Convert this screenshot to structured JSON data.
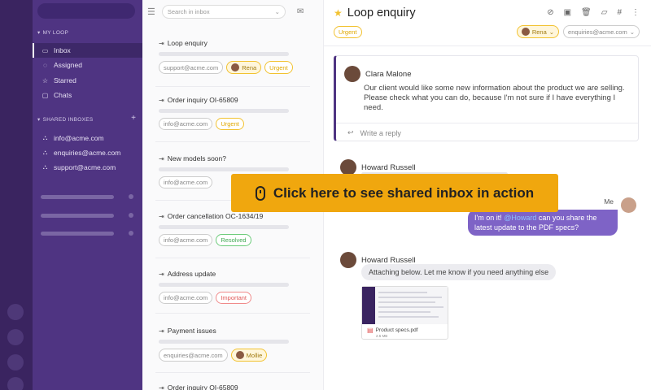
{
  "sidebar": {
    "my_loop_label": "MY LOOP",
    "items": [
      {
        "label": "Inbox",
        "icon": "inbox-icon"
      },
      {
        "label": "Assigned",
        "icon": "user-icon"
      },
      {
        "label": "Starred",
        "icon": "star-icon"
      },
      {
        "label": "Chats",
        "icon": "chat-icon"
      }
    ],
    "shared_label": "SHARED INBOXES",
    "shared_items": [
      {
        "label": "info@acme.com"
      },
      {
        "label": "enquiries@acme.com"
      },
      {
        "label": "support@acme.com"
      }
    ],
    "plus": "+"
  },
  "list": {
    "search_placeholder": "Search in inbox",
    "cards": [
      {
        "title": "Loop enquiry",
        "tags": [
          "support@acme.com",
          "Rena",
          "Urgent"
        ]
      },
      {
        "title": "Order inquiry OI-65809",
        "tags": [
          "info@acme.com",
          "Urgent"
        ]
      },
      {
        "title": "New models soon?",
        "tags": [
          "info@acme.com"
        ]
      },
      {
        "title": "Order cancellation OC-1634/19",
        "tags": [
          "info@acme.com",
          "Resolved"
        ]
      },
      {
        "title": "Address update",
        "tags": [
          "info@acme.com",
          "Important"
        ]
      },
      {
        "title": "Payment issues",
        "tags": [
          "enquiries@acme.com",
          "Mollie"
        ]
      },
      {
        "title": "Order inquiry OI-65809"
      }
    ]
  },
  "thread": {
    "title": "Loop enquiry",
    "tag": "Urgent",
    "assignee": "Rena",
    "inbox": "enquiries@acme.com",
    "first_msg": {
      "author": "Clara Malone",
      "text": "Our client would like some new information about the product we are selling. Please check what you can do, because I'm not sure if I have everything I need."
    },
    "reply_label": "Write a reply",
    "msg2_author": "Howard Russell",
    "me_label": "Me",
    "my_msg_prefix": "I'm on it! ",
    "my_msg_mention": "@Howard",
    "my_msg_suffix": " can you share the latest update to the PDF specs?",
    "msg3_author": "Howard Russell",
    "msg3_text": "Attaching below. Let me know if you need anything else",
    "attachment_name": "Product specs.pdf",
    "attachment_size": "2.5 MB"
  },
  "cta": {
    "label": "Click here to see shared inbox in action"
  },
  "colors": {
    "sidebar": "#4f3482",
    "rail": "#3a2460",
    "accent": "#f0a70e",
    "bubble": "#7e63c6",
    "urgent": "#f2c230"
  }
}
